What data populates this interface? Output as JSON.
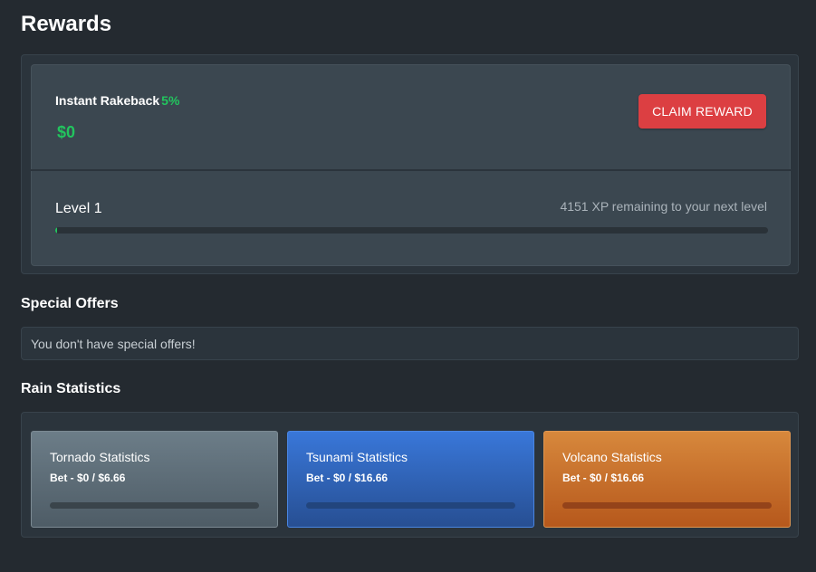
{
  "page": {
    "title": "Rewards"
  },
  "rakeback": {
    "label": "Instant Rakeback",
    "percent": "5%",
    "amount": "$0",
    "claim_label": "CLAIM REWARD",
    "accent_color": "#22c55e",
    "claim_color": "#dc3f42"
  },
  "level": {
    "label": "Level 1",
    "xp_remaining_text": "4151 XP remaining to your next level",
    "progress": 0.002
  },
  "special_offers": {
    "title": "Special Offers",
    "empty_text": "You don't have special offers!"
  },
  "rain_statistics": {
    "title": "Rain Statistics",
    "cards": [
      {
        "title": "Tornado Statistics",
        "bet_text": "Bet - $0 / $6.66",
        "progress": 0,
        "color": "#5d6d78"
      },
      {
        "title": "Tsunami Statistics",
        "bet_text": "Bet - $0 / $16.66",
        "progress": 0,
        "color": "#3168c0"
      },
      {
        "title": "Volcano Statistics",
        "bet_text": "Bet - $0 / $16.66",
        "progress": 0,
        "color": "#c8702b"
      }
    ]
  }
}
